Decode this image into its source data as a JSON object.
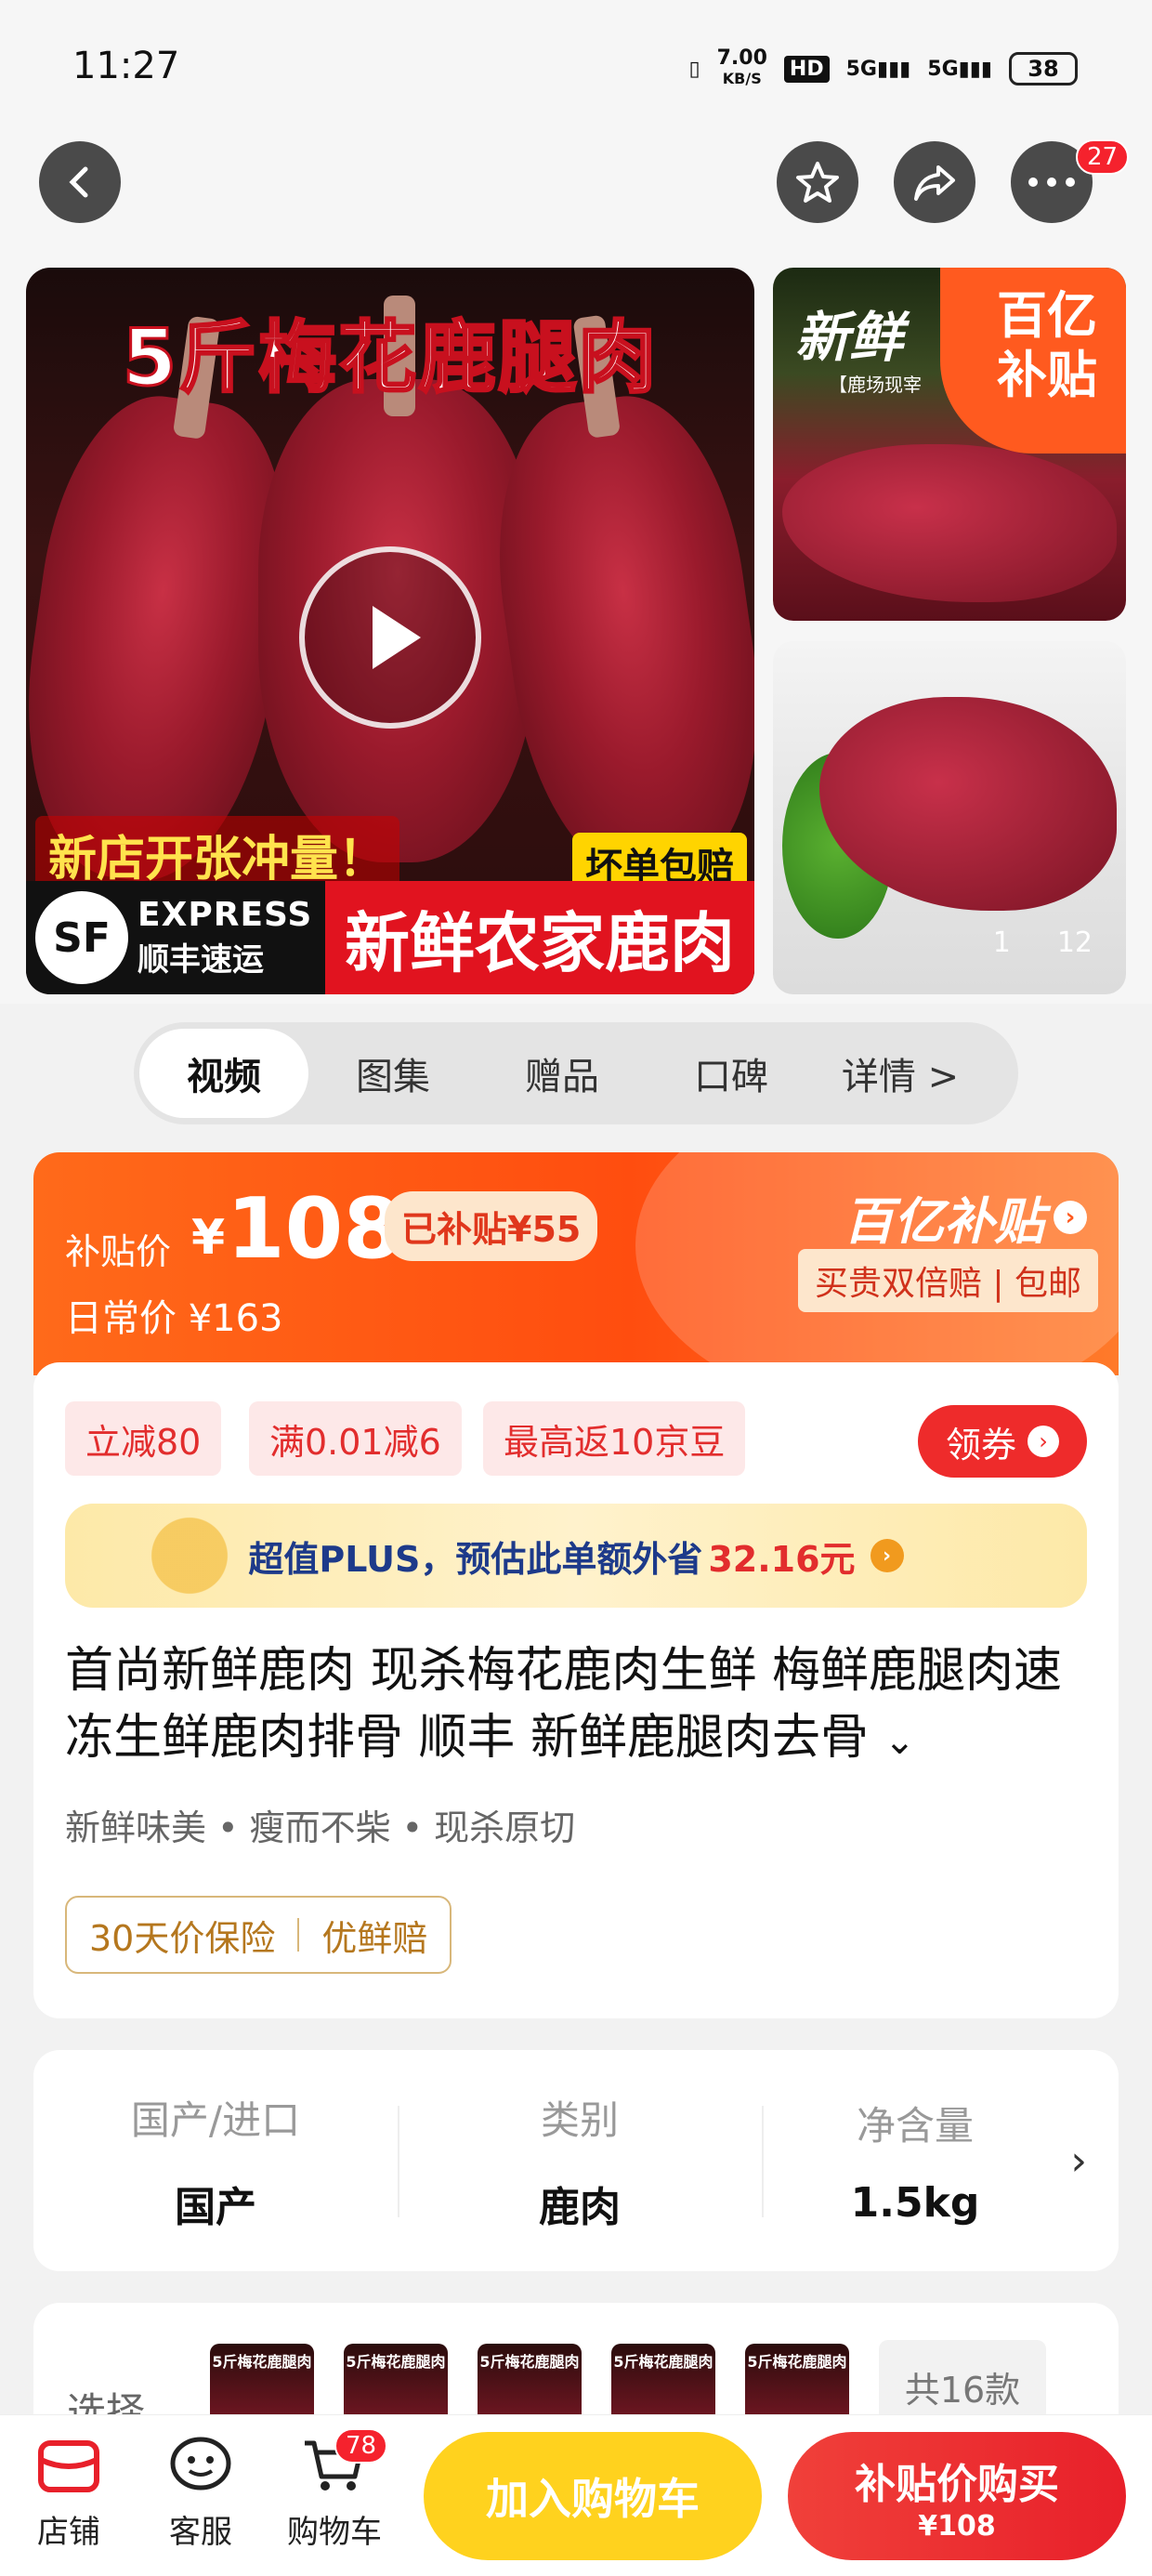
{
  "status_bar": {
    "time": "11:27",
    "net_speed": "7.00",
    "net_unit": "KB/S",
    "hd": "HD",
    "sig1": "5G",
    "sig2": "5G",
    "battery": "38"
  },
  "nav": {
    "cart_count": "27"
  },
  "gallery": {
    "main_title": "5斤梅花鹿腿肉",
    "promo_left": "新店开张冲量！",
    "promo_right": "坏单包赔",
    "sf_logo": "SF",
    "sf_en": "EXPRESS",
    "sf_cn": "顺丰速运",
    "farm": "新鲜农家鹿肉",
    "thumb_caption": "新鲜",
    "thumb_sub": "【鹿场现宰",
    "yi_badge_1": "百亿",
    "yi_badge_2": "补贴",
    "index": "1",
    "total": "12"
  },
  "tabs": [
    "视频",
    "图集",
    "赠品",
    "口碑",
    "详情 >"
  ],
  "price": {
    "label": "补贴价",
    "currency": "¥",
    "value": "108",
    "subsidized": "已补贴¥55",
    "daily": "日常价 ¥163",
    "brand": "百亿补贴",
    "guarantee": "买贵双倍赔 | 包邮"
  },
  "coupons": [
    "立减80",
    "满0.01减6",
    "最高返10京豆"
  ],
  "get_coupon": "领券",
  "plus": {
    "text": "超值PLUS，预估此单额外省",
    "value": "32.16元"
  },
  "product": {
    "title": "首尚新鲜鹿肉 现杀梅花鹿肉生鲜 梅鲜鹿腿肉速冻生鲜鹿肉排骨 顺丰 新鲜鹿腿肉去骨",
    "tags": "新鲜味美 • 瘦而不柴 • 现杀原切",
    "protect_1": "30天价保险",
    "protect_2": "优鲜赔"
  },
  "attrs": [
    {
      "key": "国产/进口",
      "value": "国产"
    },
    {
      "key": "类别",
      "value": "鹿肉"
    },
    {
      "key": "净含量",
      "value": "1.5kg"
    }
  ],
  "select": {
    "label": "选择",
    "thumb_text": "5斤梅花鹿腿肉",
    "total": "共16款"
  },
  "bottom": {
    "shop": "店铺",
    "service": "客服",
    "cart": "购物车",
    "cart_count": "78",
    "add_cart": "加入购物车",
    "buy": "补贴价购买",
    "buy_price": "¥108"
  }
}
